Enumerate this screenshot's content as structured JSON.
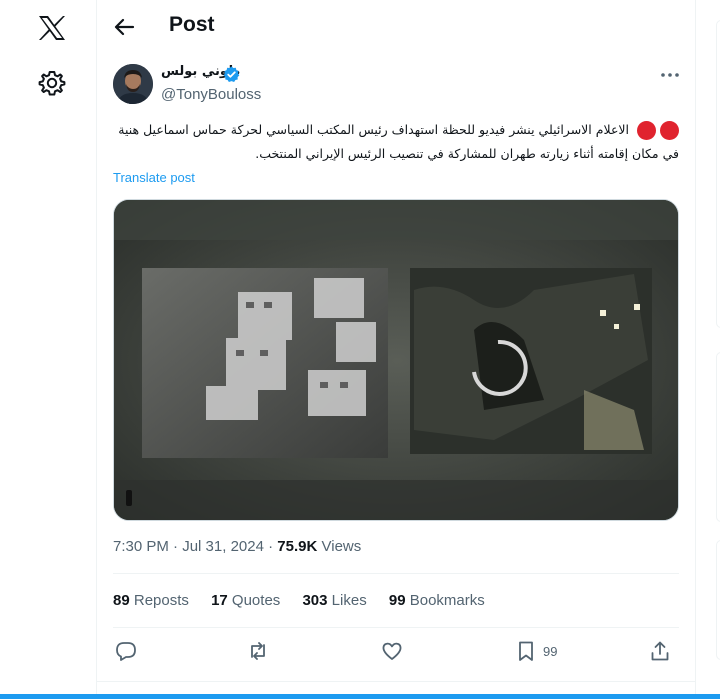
{
  "header": {
    "title": "Post"
  },
  "author": {
    "display_name": "طوني بولس",
    "handle": "@TonyBouloss"
  },
  "tweet": {
    "text": "الاعلام الاسرائيلي ينشر فيديو للحظة استهداف رئيس المكتب السياسي لحركة حماس اسماعيل هنية في مكان إقامته أثناء زيارته طهران للمشاركة في تنصيب الرئيس الإيراني المنتخب.",
    "translate_label": "Translate post",
    "time": "7:30 PM",
    "date": "Jul 31, 2024",
    "views_count": "75.9K",
    "views_label": "Views",
    "sep": "·"
  },
  "stats": {
    "reposts_count": "89",
    "reposts_label": "Reposts",
    "quotes_count": "17",
    "quotes_label": "Quotes",
    "likes_count": "303",
    "likes_label": "Likes",
    "bookmarks_count": "99",
    "bookmarks_label": "Bookmarks"
  },
  "actions": {
    "bookmark_count": "99"
  },
  "icons": [
    "x-logo-icon",
    "gear-icon",
    "back-arrow-icon",
    "verified-badge-icon",
    "more-icon",
    "reply-icon",
    "repost-icon",
    "like-icon",
    "bookmark-icon",
    "share-icon",
    "loading-spinner-icon"
  ],
  "colors": {
    "accent": "#1d9bf0",
    "text": "#0f1419",
    "muted": "#536471",
    "alert": "#e0232e"
  }
}
